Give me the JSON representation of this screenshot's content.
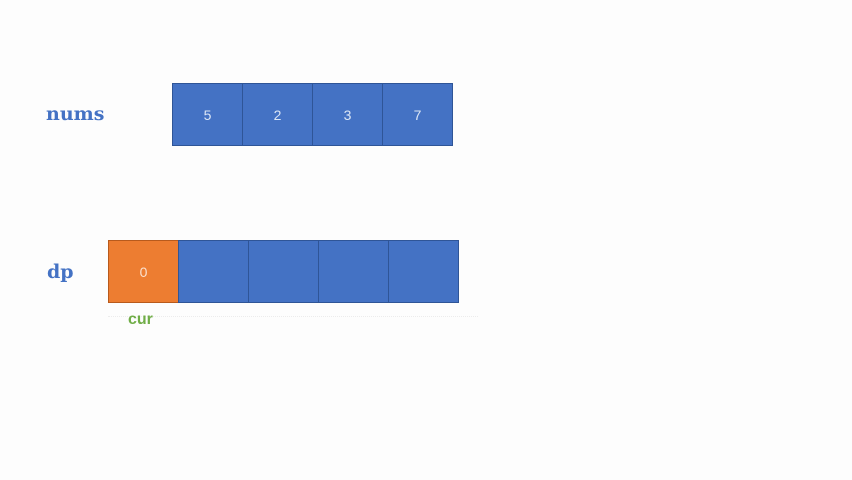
{
  "nums": {
    "label": "nums",
    "values": [
      "5",
      "2",
      "3",
      "7"
    ]
  },
  "dp": {
    "label": "dp",
    "values": [
      "0",
      "",
      "",
      "",
      ""
    ],
    "highlight_index": 0,
    "pointer_label": "cur"
  },
  "colors": {
    "cell_fill": "#4472c4",
    "cell_border": "#2f5597",
    "highlight_fill": "#ed7d31",
    "label_text": "#4472c4",
    "pointer_text": "#70ad47"
  }
}
